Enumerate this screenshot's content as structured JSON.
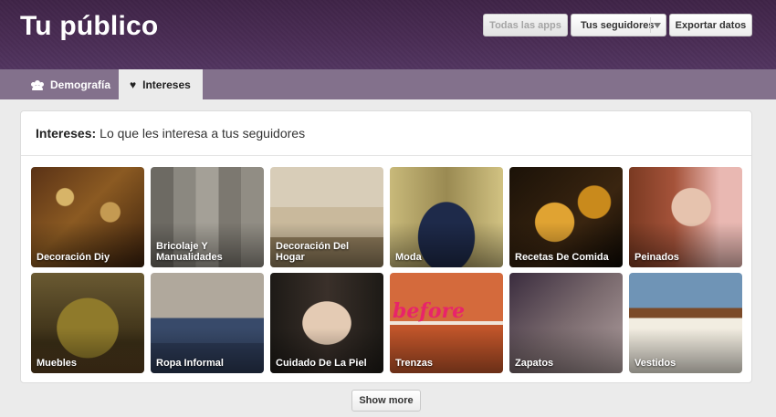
{
  "header": {
    "title": "Tu público",
    "buttons": {
      "all_apps": "Todas las apps",
      "followers": "Tus seguidores",
      "export": "Exportar datos"
    }
  },
  "tabs": [
    {
      "label": "Demografía",
      "icon": "people-icon",
      "active": false
    },
    {
      "label": "Intereses",
      "icon": "heart-icon",
      "active": true
    }
  ],
  "interests": {
    "heading_bold": "Intereses:",
    "heading_rest": "Lo que les interesa a tus seguidores",
    "tiles": [
      {
        "label": "Decoración Diy"
      },
      {
        "label": "Bricolaje Y Manualidades"
      },
      {
        "label": "Decoración Del Hogar"
      },
      {
        "label": "Moda"
      },
      {
        "label": "Recetas De Comida"
      },
      {
        "label": "Peinados"
      },
      {
        "label": "Muebles"
      },
      {
        "label": "Ropa Informal"
      },
      {
        "label": "Cuidado De La Piel"
      },
      {
        "label": "Trenzas",
        "overlay_text": "before"
      },
      {
        "label": "Zapatos"
      },
      {
        "label": "Vestidos"
      }
    ]
  },
  "show_more_label": "Show more",
  "colors": {
    "header_bg": "#4a2d55",
    "tabbar_bg": "#83718c",
    "page_bg": "#ebebeb"
  }
}
